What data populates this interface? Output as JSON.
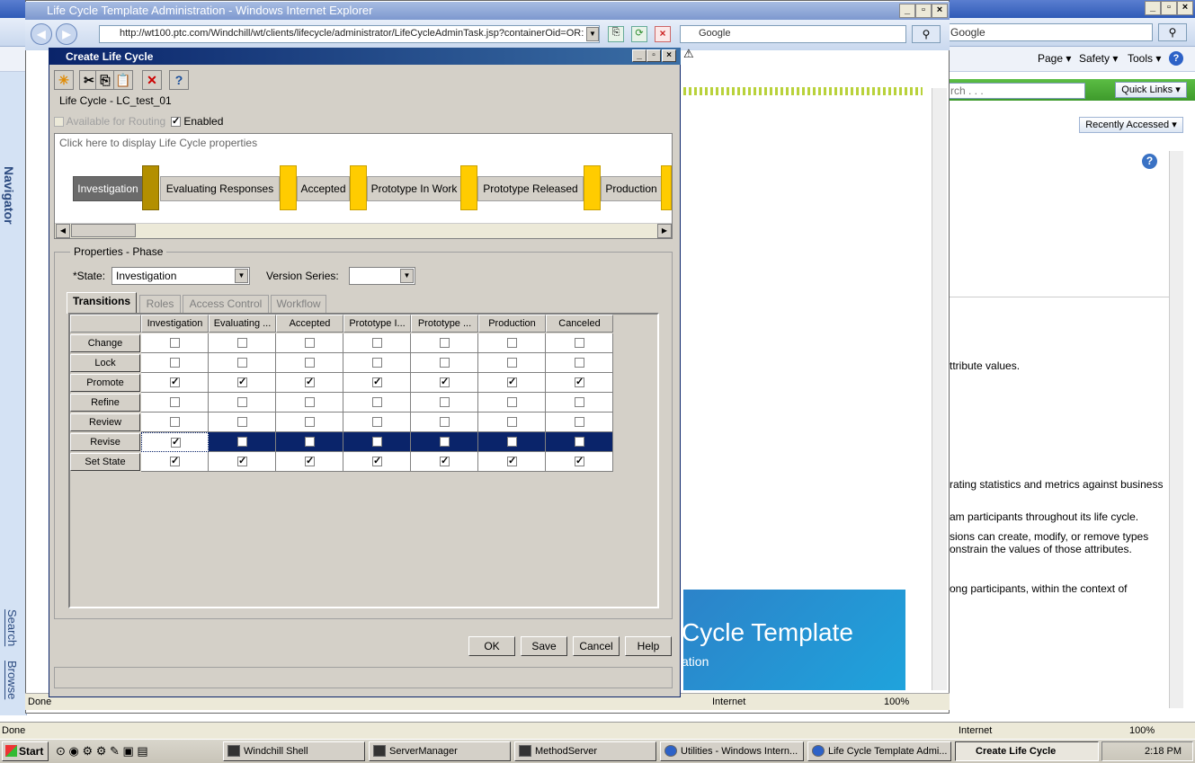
{
  "background_browser": {
    "search_placeholder": "Google",
    "menu": [
      "Page ▾",
      "Safety ▾",
      "Tools ▾"
    ],
    "header_search": "rch . . .",
    "quick_links": "Quick Links ▾",
    "recently_accessed": "Recently Accessed ▾",
    "navigator_label": "Navigator",
    "search_tab": "Search",
    "browse_tab": "Browse",
    "texts": [
      "ttribute values.",
      "rating statistics and metrics against business",
      "am participants throughout its life cycle.",
      "sions can create, modify, or remove types",
      "onstrain the values of those attributes.",
      "ong participants, within the context of"
    ],
    "status": {
      "left": "Done",
      "zone": "Internet",
      "zoom": "100%"
    }
  },
  "ie_window": {
    "title": "Life Cycle Template Administration - Windows Internet Explorer",
    "address": "http://wt100.ptc.com/Windchill/wt/clients/lifecycle/administrator/LifeCycleAdminTask.jsp?containerOid=OR:",
    "search_placeholder": "Google",
    "banner_title": "Cycle Template",
    "banner_sub": "ation",
    "status": {
      "left": "Done",
      "zone": "Internet",
      "zoom": "100%"
    }
  },
  "dialog": {
    "title": "Create Life Cycle",
    "lifecycle_name": "Life Cycle - LC_test_01",
    "available_for_routing": "Available for Routing",
    "enabled": "Enabled",
    "phase_hint": "Click here to display Life Cycle properties",
    "phases": [
      "Investigation",
      "Evaluating Responses",
      "Accepted",
      "Prototype In Work",
      "Prototype Released",
      "Production"
    ],
    "properties_legend": "Properties - Phase",
    "state_label": "*State:",
    "state_value": "Investigation",
    "version_series_label": "Version Series:",
    "tabs": [
      "Transitions",
      "Roles",
      "Access Control",
      "Workflow"
    ],
    "columns": [
      "Investigation",
      "Evaluating ...",
      "Accepted",
      "Prototype I...",
      "Prototype ...",
      "Production",
      "Canceled"
    ],
    "rows": [
      {
        "label": "Change",
        "checks": [
          false,
          false,
          false,
          false,
          false,
          false,
          false
        ]
      },
      {
        "label": "Lock",
        "checks": [
          false,
          false,
          false,
          false,
          false,
          false,
          false
        ]
      },
      {
        "label": "Promote",
        "checks": [
          true,
          true,
          true,
          true,
          true,
          true,
          true
        ]
      },
      {
        "label": "Refine",
        "checks": [
          false,
          false,
          false,
          false,
          false,
          false,
          false
        ]
      },
      {
        "label": "Review",
        "checks": [
          false,
          false,
          false,
          false,
          false,
          false,
          false
        ]
      },
      {
        "label": "Revise",
        "checks": [
          true,
          false,
          false,
          false,
          false,
          false,
          false
        ],
        "selected": true
      },
      {
        "label": "Set State",
        "checks": [
          true,
          true,
          true,
          true,
          true,
          true,
          true
        ]
      }
    ],
    "buttons": {
      "ok": "OK",
      "save": "Save",
      "cancel": "Cancel",
      "help": "Help"
    }
  },
  "taskbar": {
    "start": "Start",
    "tasks": [
      "Windchill Shell",
      "ServerManager",
      "MethodServer",
      "Utilities - Windows Intern...",
      "Life Cycle Template Admi...",
      "Create Life Cycle"
    ],
    "clock": "2:18 PM"
  }
}
